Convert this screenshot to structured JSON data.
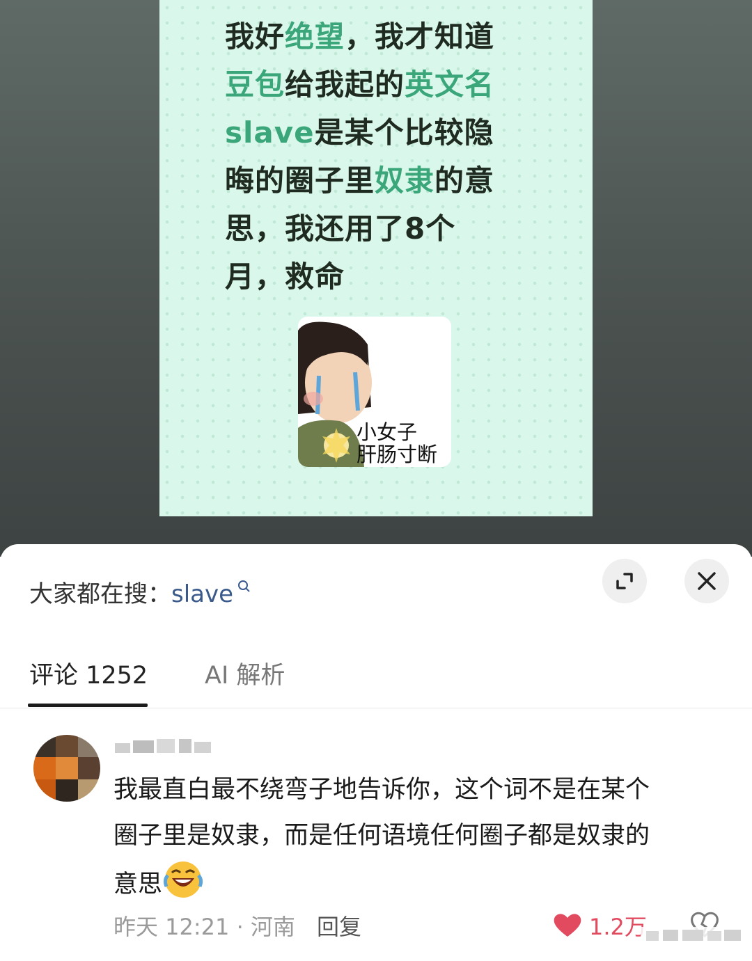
{
  "post": {
    "lines": [
      [
        {
          "t": "我好",
          "hl": false
        },
        {
          "t": "绝望",
          "hl": true
        },
        {
          "t": "，我才知道",
          "hl": false
        }
      ],
      [
        {
          "t": "豆包",
          "hl": true
        },
        {
          "t": "给我起的",
          "hl": false
        },
        {
          "t": "英文名",
          "hl": true
        }
      ],
      [
        {
          "t": "slave",
          "hl": true
        },
        {
          "t": "是某个比较隐",
          "hl": false
        }
      ],
      [
        {
          "t": "晦的圈子里",
          "hl": false
        },
        {
          "t": "奴隶",
          "hl": true
        },
        {
          "t": "的意",
          "hl": false
        }
      ],
      [
        {
          "t": "思，我还用了8个",
          "hl": false
        }
      ],
      [
        {
          "t": "月，救命",
          "hl": false
        }
      ]
    ],
    "sticker_caption_1": "小女子",
    "sticker_caption_2": "肝肠寸断"
  },
  "search": {
    "prefix": "大家都在搜：",
    "term": "slave",
    "icon": "search-icon"
  },
  "tabs": {
    "comments": "评论 1252",
    "ai": "AI 解析",
    "active": "comments"
  },
  "comment": {
    "text_main": "我最直白最不绕弯子地告诉你，这个词不是在某个圈子里是奴隶，而是任何语境任何圈子都是奴隶的意思",
    "emoji": "laughing-crying-emoji",
    "time_location": "昨天 12:21 · 河南",
    "reply_label": "回复",
    "likes": "1.2万"
  },
  "colors": {
    "highlight_green": "#3aa67a",
    "like_red": "#e24b5f",
    "search_blue": "#3b5a8c"
  }
}
